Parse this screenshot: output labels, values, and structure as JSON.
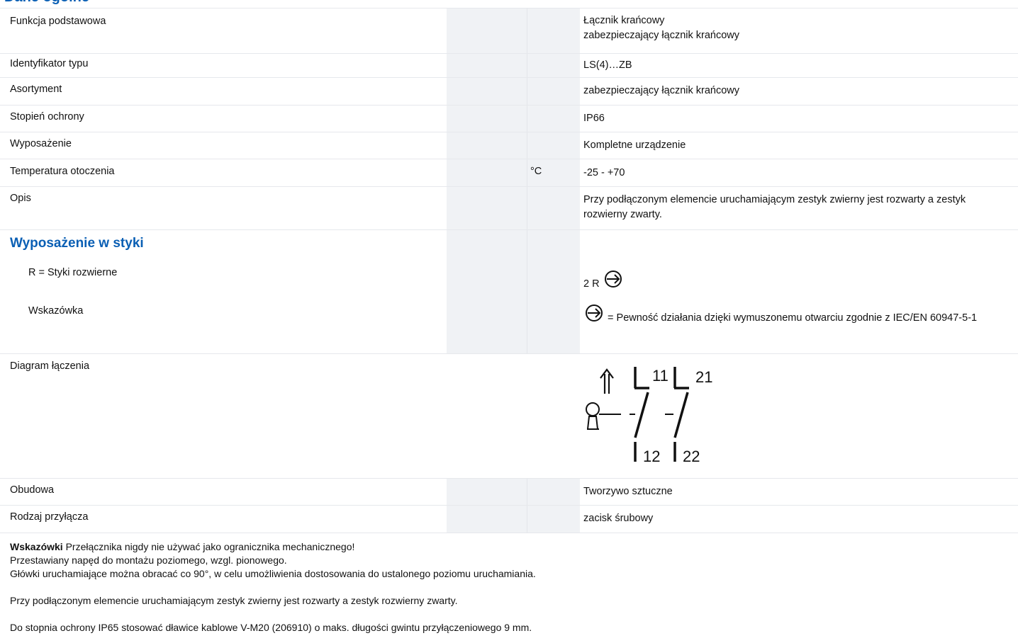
{
  "header": {
    "section_title": "Dane ogólne"
  },
  "rows": [
    {
      "label": "Funkcja podstawowa",
      "unit": "",
      "value_line1": "Łącznik krańcowy",
      "value_line2": "zabezpieczający łącznik krańcowy"
    },
    {
      "label": "Identyfikator typu",
      "unit": "",
      "value": "LS(4)…ZB"
    },
    {
      "label": "Asortyment",
      "unit": "",
      "value": "zabezpieczający łącznik krańcowy"
    },
    {
      "label": "Stopień ochrony",
      "unit": "",
      "value": "IP66"
    },
    {
      "label": "Wyposażenie",
      "unit": "",
      "value": "Kompletne urządzenie"
    },
    {
      "label": "Temperatura otoczenia",
      "unit": "°C",
      "value": "-25 - +70"
    },
    {
      "label": "Opis",
      "unit": "",
      "value": "Przy podłączonym elemencie uruchamiającym zestyk zwierny jest rozwarty a zestyk rozwierny zwarty."
    }
  ],
  "contacts_section": {
    "title": "Wyposażenie w styki",
    "rows": [
      {
        "label": "R = Styki rozwierne",
        "value": "2 R",
        "icon": "positive-opening-icon"
      },
      {
        "label": "Wskazówka",
        "value": "= Pewność działania dzięki wymuszonemu otwarciu zgodnie z IEC/EN 60947-5-1",
        "icon": "positive-opening-icon"
      }
    ]
  },
  "diagram_row": {
    "label": "Diagram łączenia",
    "terminals": {
      "t11": "11",
      "t21": "21",
      "t12": "12",
      "t22": "22"
    }
  },
  "rows_after": [
    {
      "label": "Obudowa",
      "value": "Tworzywo sztuczne"
    },
    {
      "label": "Rodzaj przyłącza",
      "value": "zacisk śrubowy"
    }
  ],
  "notes": {
    "heading": "Wskazówki",
    "line1": "Przełącznika nigdy nie używać jako ogranicznika mechanicznego!",
    "line2": "Przestawiany napęd do montażu poziomego, wzgl. pionowego.",
    "line3": "Główki uruchamiające można obracać co 90°, w celu umożliwienia dostosowania do ustalonego poziomu uruchamiania.",
    "para2": "Przy podłączonym elemencie uruchamiającym zestyk zwierny jest rozwarty a zestyk rozwierny zwarty.",
    "para3": "Do stopnia ochrony IP65 stosować dławice kablowe V-M20 (206910) o maks. długości gwintu przyłączeniowego 9 mm."
  }
}
